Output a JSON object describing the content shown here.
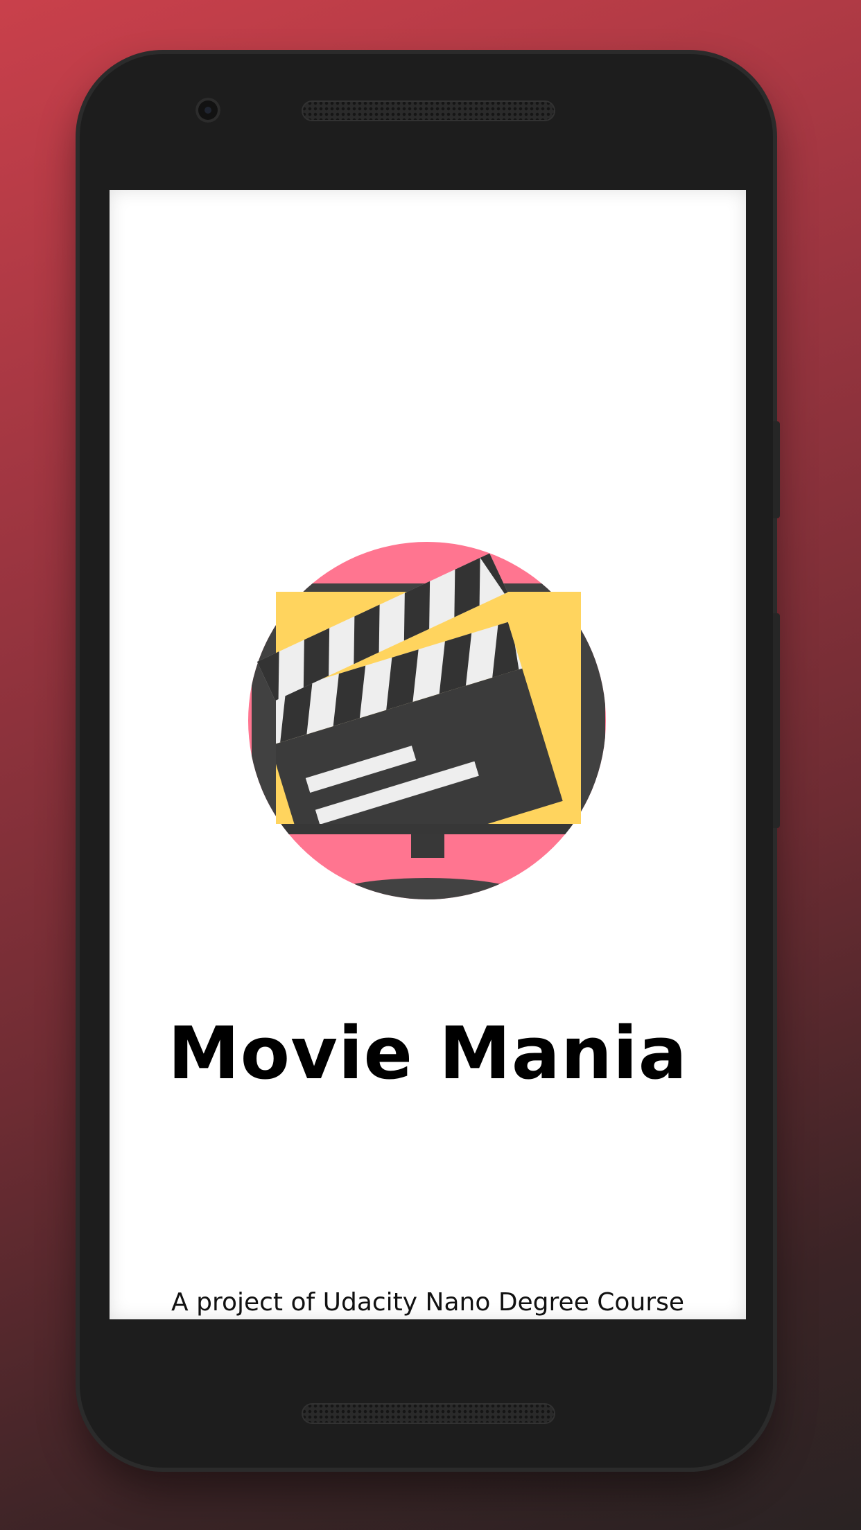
{
  "app": {
    "title": "Movie Mania",
    "subtitle": "A project of Udacity Nano Degree Course"
  },
  "logo": {
    "icon": "clapperboard-tv-icon",
    "colors": {
      "circle": "#ff7590",
      "screen": "#ffd45e",
      "frame": "#414141",
      "stripe_light": "#eeeeee",
      "stripe_dark": "#333333"
    }
  },
  "device": {
    "background_gradient": [
      "#c9404b",
      "#2a2323"
    ],
    "body_color": "#1d1d1d"
  }
}
